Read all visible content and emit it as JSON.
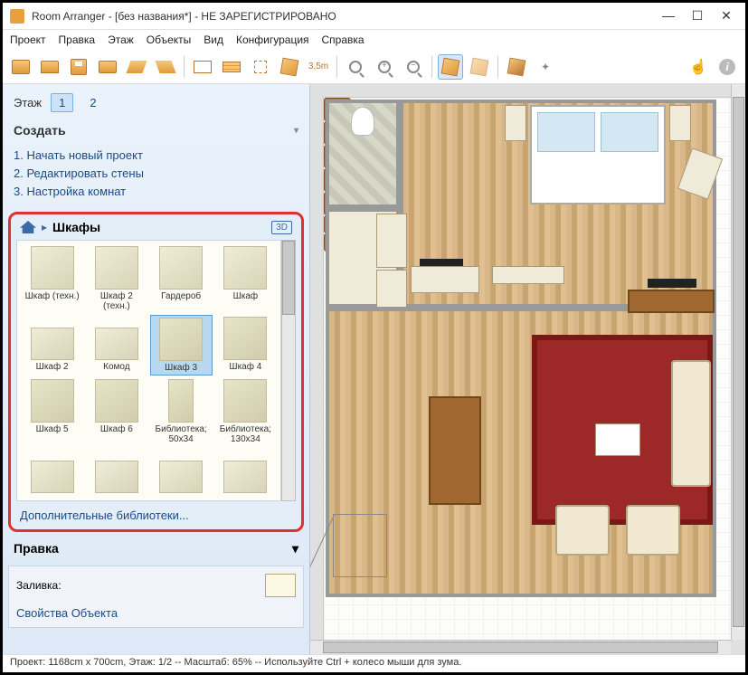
{
  "window": {
    "title": "Room Arranger - [без названия*] - НЕ ЗАРЕГИСТРИРОВАНО"
  },
  "menu": [
    "Проект",
    "Правка",
    "Этаж",
    "Объекты",
    "Вид",
    "Конфигурация",
    "Справка"
  ],
  "sidebar": {
    "floor_label": "Этаж",
    "floors": [
      "1",
      "2"
    ],
    "create_head": "Создать",
    "create_items": [
      "1. Начать новый проект",
      "2. Редактировать стены",
      "3. Настройка комнат"
    ],
    "library": {
      "title": "Шкафы",
      "tag": "3D",
      "items": [
        "Шкаф (техн.)",
        "Шкаф 2 (техн.)",
        "Гардероб",
        "Шкаф",
        "Шкаф 2",
        "Комод",
        "Шкаф 3",
        "Шкаф 4",
        "Шкаф 5",
        "Шкаф 6",
        "Библиотека; 50x34",
        "Библиотека; 130x34",
        "",
        "",
        "",
        ""
      ],
      "selected_index": 6,
      "more_link": "Дополнительные библиотеки..."
    },
    "edit_head": "Правка",
    "fill_label": "Заливка:",
    "obj_props": "Свойства Объекта"
  },
  "status": "Проект: 1168cm x 700cm, Этаж: 1/2 -- Масштаб: 65% -- Используйте Ctrl + колесо мыши для зума."
}
